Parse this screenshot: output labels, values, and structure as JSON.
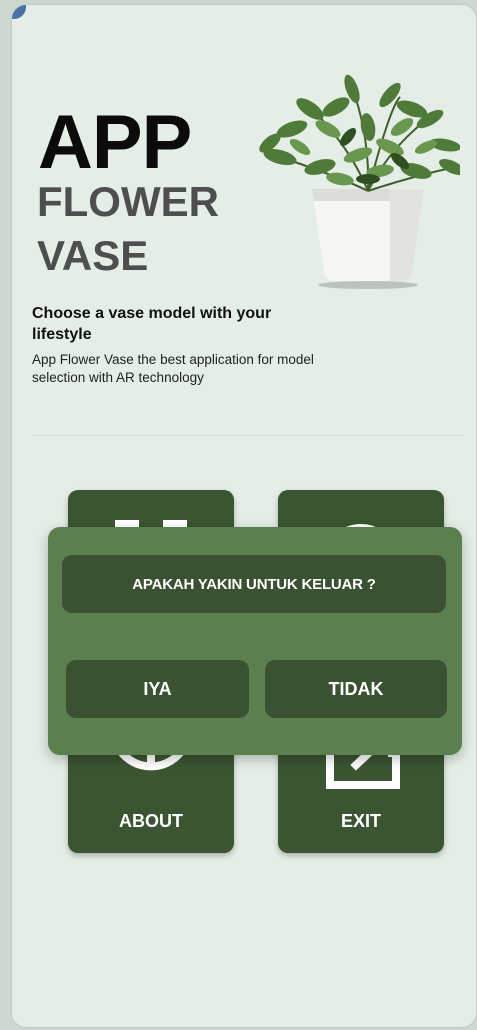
{
  "header": {
    "title_line1": "APP",
    "title_line2": "FLOWER",
    "title_line3": "VASE"
  },
  "intro": {
    "headline": "Choose a vase model with your lifestyle",
    "description": "App Flower Vase the best application for model selection with AR technology"
  },
  "menu": {
    "about_label": "ABOUT",
    "exit_label": "EXIT",
    "top_left_icon": "scan-icon",
    "top_right_icon": "help-icon",
    "about_icon": "info-icon",
    "exit_icon": "exit-icon"
  },
  "dialog": {
    "question": "APAKAH YAKIN UNTUK KELUAR ?",
    "yes_label": "IYA",
    "no_label": "TIDAK"
  },
  "colors": {
    "background": "#e4ede6",
    "card": "#3b5532",
    "dialog": "#5b7f4f",
    "dialog_button": "#3a5232"
  }
}
